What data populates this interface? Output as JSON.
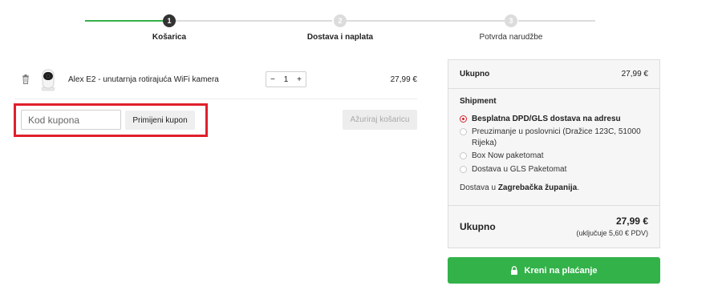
{
  "stepper": {
    "steps": [
      {
        "number": "1",
        "label": "Košarica"
      },
      {
        "number": "2",
        "label": "Dostava i naplata"
      },
      {
        "number": "3",
        "label": "Potvrda narudžbe"
      }
    ]
  },
  "cart": {
    "items": [
      {
        "name": "Alex E2 - unutarnja rotirajuća WiFi kamera",
        "quantity": "1",
        "price": "27,99 €",
        "minus": "−",
        "plus": "+"
      }
    ]
  },
  "coupon": {
    "placeholder": "Kod kupona",
    "apply_label": "Primijeni kupon",
    "update_label": "Ažuriraj košaricu"
  },
  "summary": {
    "subtotal_label": "Ukupno",
    "subtotal_value": "27,99 €",
    "shipment_title": "Shipment",
    "shipping_options": [
      {
        "label": "Besplatna DPD/GLS dostava na adresu",
        "selected": true
      },
      {
        "label": "Preuzimanje u poslovnici (Dražice 123C, 51000 Rijeka)",
        "selected": false
      },
      {
        "label": "Box Now paketomat",
        "selected": false
      },
      {
        "label": "Dostava u GLS Paketomat",
        "selected": false
      }
    ],
    "destination_prefix": "Dostava u ",
    "destination_region": "Zagrebačka županija",
    "destination_suffix": ".",
    "total_label": "Ukupno",
    "total_value": "27,99 €",
    "tax_note": "(uključuje 5,60 € PDV)"
  },
  "checkout": {
    "label": "Kreni na plaćanje"
  },
  "colors": {
    "accent_green": "#33b24a",
    "highlight_red": "#e0202b",
    "radio_selected": "#d6202b"
  }
}
